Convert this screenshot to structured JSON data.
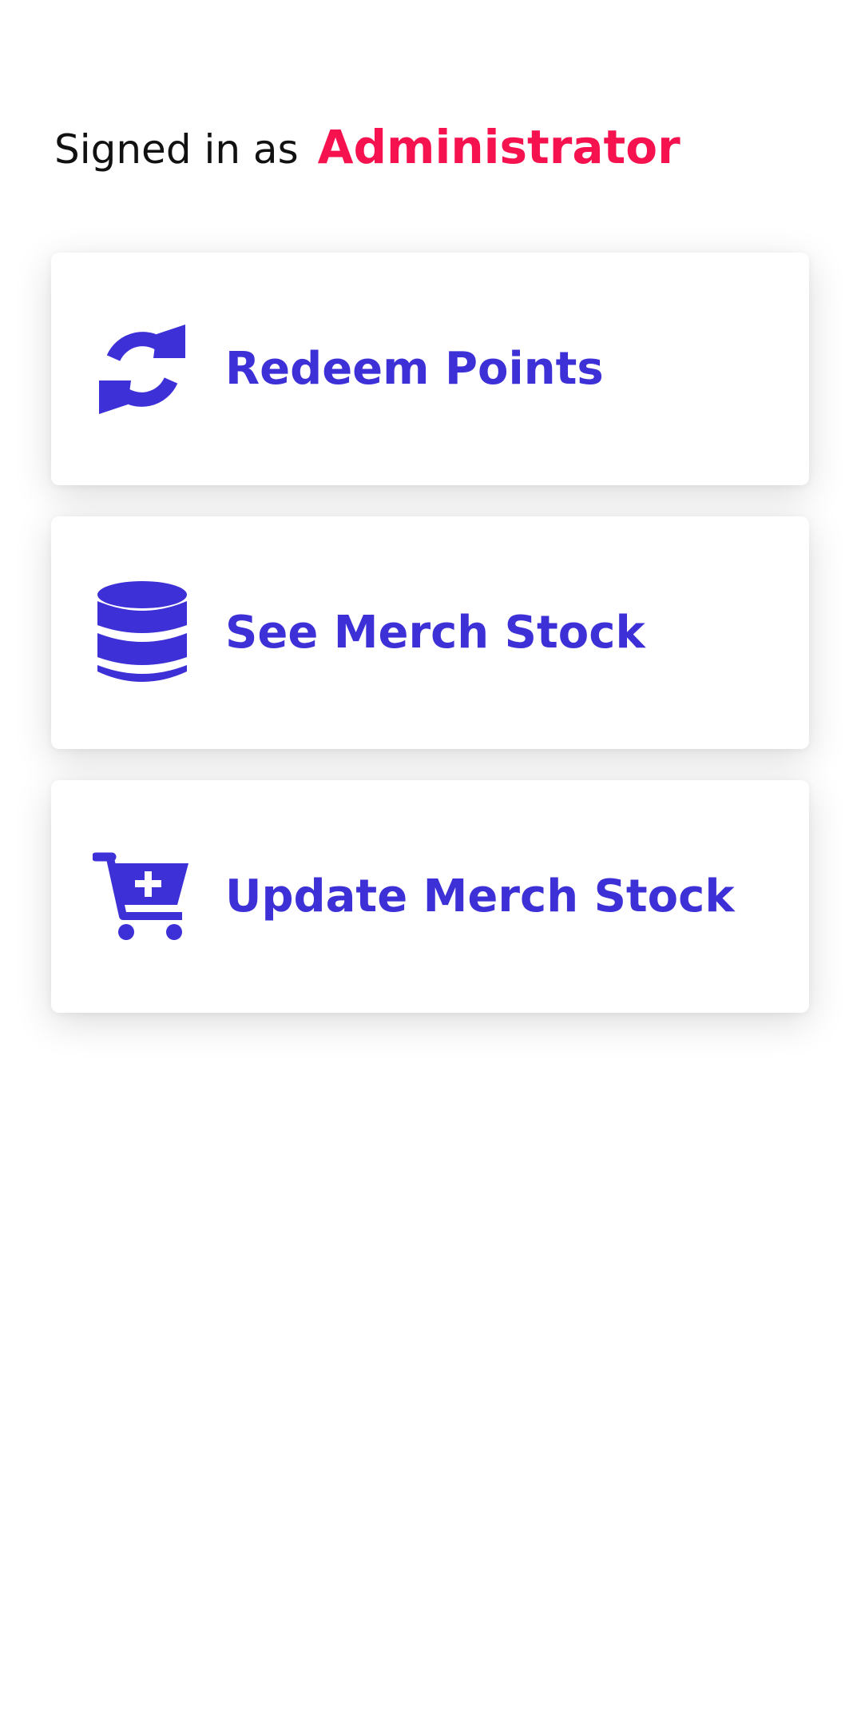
{
  "header": {
    "signed_in_label": "Signed in as",
    "role": "Administrator"
  },
  "menu": {
    "items": [
      {
        "label": "Redeem Points",
        "icon": "sync-icon"
      },
      {
        "label": "See Merch Stock",
        "icon": "database-icon"
      },
      {
        "label": "Update Merch Stock",
        "icon": "cart-plus-icon"
      }
    ]
  },
  "colors": {
    "accent": "#3d30d6",
    "role": "#f5124f",
    "text": "#111111",
    "background": "#ffffff"
  }
}
